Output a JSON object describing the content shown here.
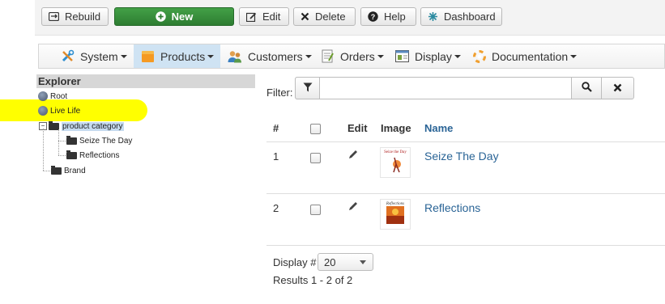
{
  "toolbar": {
    "rebuild": "Rebuild",
    "new": "New",
    "edit": "Edit",
    "delete": "Delete",
    "help": "Help",
    "dashboard": "Dashboard"
  },
  "menu": {
    "items": [
      "System",
      "Products",
      "Customers",
      "Orders",
      "Display",
      "Documentation"
    ],
    "active": "Products"
  },
  "explorer": {
    "title": "Explorer",
    "nodes": [
      "Root",
      "Live Life",
      "product category",
      "Seize The Day",
      "Reflections",
      "Brand"
    ]
  },
  "filter": {
    "label": "Filter:",
    "value": ""
  },
  "table": {
    "headers": {
      "num": "#",
      "edit": "Edit",
      "image": "Image",
      "name": "Name"
    },
    "rows": [
      {
        "num": "1",
        "name": "Seize The Day",
        "image_title": "Seize the Day"
      },
      {
        "num": "2",
        "name": "Reflections",
        "image_title": "Reflections"
      }
    ]
  },
  "footer": {
    "display_label": "Display #",
    "display_value": "20",
    "results": "Results 1 - 2 of 2"
  },
  "colors": {
    "highlight": "#ffff00",
    "new_button": "#2e7d32",
    "link": "#2a6496",
    "active_menu": "#cfe3f3"
  }
}
